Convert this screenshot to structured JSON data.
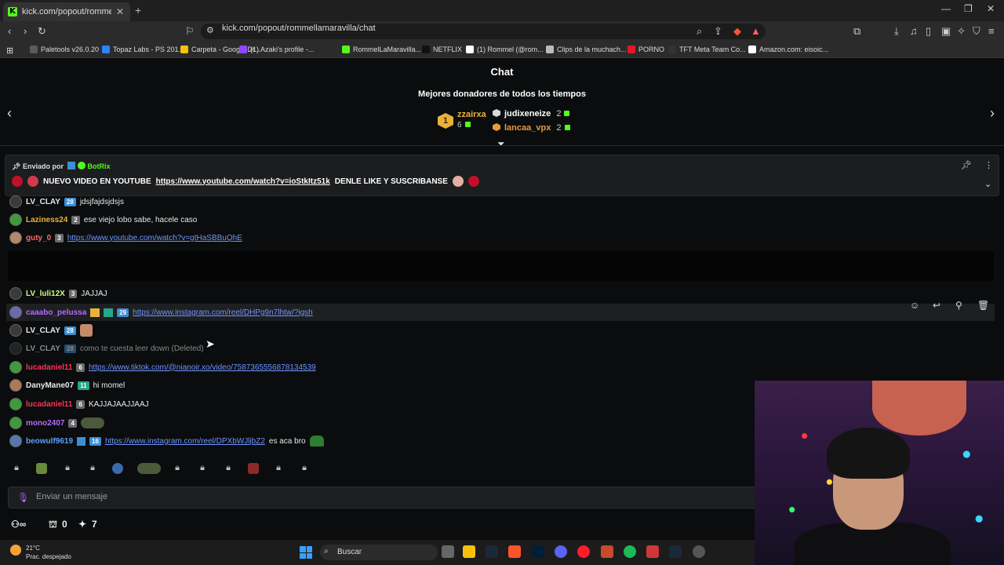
{
  "browser": {
    "tab_title": "kick.com/popout/rommellamaravilla",
    "tab_close": "✕",
    "new_tab": "+",
    "url": "kick.com/popout/rommellamaravilla/chat",
    "bookmarks": [
      {
        "label": "Paletools v26.0.20",
        "color": "#5a5a5a"
      },
      {
        "label": "Topaz Labs - PS 201...",
        "color": "#2a84ff"
      },
      {
        "label": "Carpeta - Google Dr...",
        "color": "#f4c20d"
      },
      {
        "label": "(1) Azaki's profile -...",
        "color": "#9146ff"
      },
      {
        "label": "RommelLaMaravilla...",
        "color": "#53fc18"
      },
      {
        "label": "NETFLIX",
        "color": "#111111"
      },
      {
        "label": "(1) Rommel (@rom...",
        "color": "#ffffff"
      },
      {
        "label": "Clips de la muchach...",
        "color": "#bbbbbb"
      },
      {
        "label": "PORNO",
        "color": "#e01b24"
      },
      {
        "label": "TFT Meta Team Co...",
        "color": "#333333"
      },
      {
        "label": "Amazon.com: eisoic...",
        "color": "#ffffff"
      }
    ]
  },
  "chat": {
    "title": "Chat",
    "donors_title": "Mejores donadores de todos los tiempos",
    "donors": [
      {
        "rank": "1",
        "name": "zzairxa",
        "count": "6",
        "color": "#e8b23a"
      },
      {
        "rank": "2",
        "name": "judixeneize",
        "count": "2",
        "color": "#ffffff"
      },
      {
        "rank": "3",
        "name": "lancaa_vpx",
        "count": "2",
        "color": "#e89a3a"
      }
    ],
    "pinned": {
      "sent_by_label": "Enviado por",
      "sender": "BotRix",
      "text_before": "NUEVO VIDEO EN YOUTUBE",
      "link": "https://www.youtube.com/watch?v=ioStkItz51k",
      "text_after": "DENLE LIKE Y SUSCRIBANSE"
    },
    "messages": [
      {
        "user": "LV_CLAY",
        "color": "#e8e8e8",
        "badge": "28",
        "text": "jdsjfajdsjdsjs"
      },
      {
        "user": "Laziness24",
        "color": "#e8b23a",
        "badge": "2",
        "text": "ese viejo lobo sabe, hacele caso"
      },
      {
        "user": "guty_0",
        "color": "#ff6b6b",
        "badge": "3",
        "link": "https://www.youtube.com/watch?v=gtHaSBBuQhE"
      },
      {
        "user": "LV_luli12X",
        "color": "#c8ff7a",
        "badge": "3",
        "text": "JAJJAJ"
      },
      {
        "user": "caaabo_pelussa",
        "color": "#b36bff",
        "badge": "29",
        "link": "https://www.instagram.com/reel/DHPg9n7lhtw/?igsh"
      },
      {
        "user": "LV_CLAY",
        "color": "#e8e8e8",
        "badge": "28",
        "text": ""
      },
      {
        "user": "LV_CLAY",
        "color": "#8a8a8a",
        "badge": "28",
        "text": "como te cuesta leer down (Deleted)"
      },
      {
        "user": "lucadaniel11",
        "color": "#ff3355",
        "badge": "6",
        "link": "https://www.tiktok.com/@nianoir.xo/video/7587365556878134539"
      },
      {
        "user": "DanyMane07",
        "color": "#e8e8e8",
        "badge": "11",
        "text": "hi momel"
      },
      {
        "user": "lucadaniel11",
        "color": "#ff3355",
        "badge": "6",
        "text": "KAJJAJAAJJAAJ"
      },
      {
        "user": "mono2407",
        "color": "#b36bff",
        "badge": "4",
        "text": ""
      },
      {
        "user": "beowulf9619",
        "color": "#5aa0ff",
        "badge": "16",
        "link": "https://www.instagram.com/reel/DPXbWJljbZ2",
        "text_after": "es aca bro"
      }
    ],
    "input_placeholder": "Enviar un mensaje",
    "footer": {
      "points": "0",
      "stars": "7"
    }
  },
  "taskbar": {
    "temperature": "21°C",
    "weather": "Prac. despejado",
    "search": "Buscar"
  }
}
